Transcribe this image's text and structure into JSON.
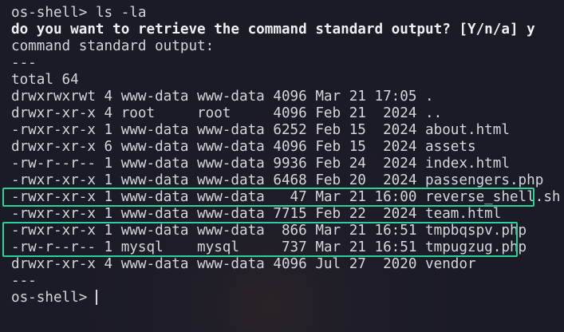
{
  "terminal": {
    "prompt": "os-shell> ",
    "command": "ls -la",
    "question": "do you want to retrieve the command standard output? [Y/n/a] y",
    "output_header": "command standard output:",
    "separator": "---",
    "total": "total 64",
    "listing": [
      "drwxrwxrwt 4 www-data www-data 4096 Mar 21 17:05 .",
      "drwxr-xr-x 4 root     root     4096 Feb 21  2024 ..",
      "-rwxr-xr-x 1 www-data www-data 6252 Feb 15  2024 about.html",
      "drwxr-xr-x 6 www-data www-data 4096 Feb 15  2024 assets",
      "-rw-r--r-- 1 www-data www-data 9936 Feb 24  2024 index.html",
      "-rwxr-xr-x 1 www-data www-data 6468 Feb 20  2024 passengers.php",
      "-rwxr-xr-x 1 www-data www-data   47 Mar 21 16:00 reverse_shell.sh",
      "-rwxr-xr-x 1 www-data www-data 7715 Feb 22  2024 team.html",
      "-rwxr-xr-x 1 www-data www-data  866 Mar 21 16:51 tmpbqspv.php",
      "-rw-r--r-- 1 mysql    mysql     737 Mar 21 16:51 tmpugzug.php",
      "drwxr-xr-x 4 www-data www-data 4096 Jul 27  2020 vendor"
    ],
    "end_separator": "---",
    "final_prompt": "os-shell> "
  },
  "colors": {
    "background": "#1b1b26",
    "text": "#d4d6dd",
    "highlight_box": "#2cd19a"
  }
}
